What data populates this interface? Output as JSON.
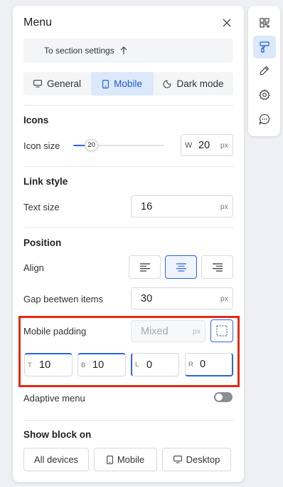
{
  "panel": {
    "title": "Menu",
    "section_link": "To section settings",
    "tabs": [
      {
        "label": "General",
        "icon": "monitor-icon"
      },
      {
        "label": "Mobile",
        "icon": "mobile-icon",
        "active": true
      },
      {
        "label": "Dark mode",
        "icon": "moon-icon"
      }
    ]
  },
  "icons": {
    "heading": "Icons",
    "size_label": "Icon size",
    "slider_value": "20",
    "slider_fraction": 0.2,
    "width_prefix": "W",
    "width_value": "20",
    "width_unit": "px"
  },
  "link_style": {
    "heading": "Link style",
    "text_size_label": "Text size",
    "text_size_value": "16",
    "text_size_unit": "px"
  },
  "position": {
    "heading": "Position",
    "align_label": "Align",
    "align_selected": "center",
    "gap_label": "Gap beetwen items",
    "gap_value": "30",
    "gap_unit": "px",
    "mobile_padding_label": "Mobile padding",
    "mobile_padding_placeholder": "Mixed",
    "mobile_padding_unit": "px",
    "padding": [
      {
        "prefix": "T",
        "value": "10"
      },
      {
        "prefix": "B",
        "value": "10"
      },
      {
        "prefix": "L",
        "value": "0"
      },
      {
        "prefix": "R",
        "value": "0"
      }
    ],
    "adaptive_label": "Adaptive menu",
    "adaptive_on": false
  },
  "show_block": {
    "heading": "Show block on",
    "options": [
      "All devices",
      "Mobile",
      "Desktop"
    ]
  },
  "colors": {
    "accent": "#2a66e0",
    "accent_bg": "#dce8fb",
    "highlight": "#e22a16"
  },
  "toolbar": {
    "items": [
      "qr-code-icon",
      "paint-roller-icon",
      "pencil-icon",
      "gear-icon",
      "chat-icon"
    ],
    "active": "paint-roller-icon"
  }
}
